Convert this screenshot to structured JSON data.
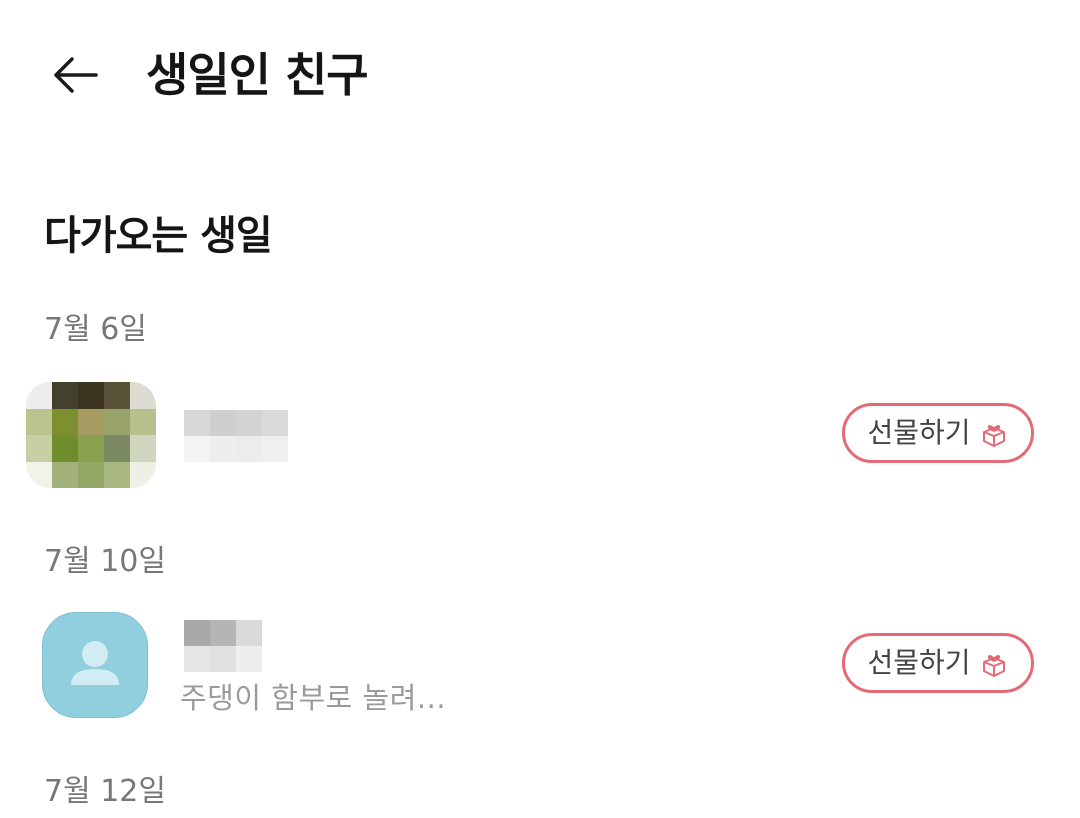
{
  "header": {
    "back_icon": "arrow-left-icon",
    "title": "생일인 친구"
  },
  "section": {
    "title": "다가오는 생일"
  },
  "birthdays": [
    {
      "date": "7월 6일",
      "friend": {
        "avatar": "pixelated-photo",
        "name_hidden": true,
        "status": ""
      },
      "gift_label": "선물하기",
      "gift_icon": "gift-box-heart-icon"
    },
    {
      "date": "7월 10일",
      "friend": {
        "avatar": "default-person-icon",
        "name_hidden": true,
        "status": "주댕이 함부로 놀려..."
      },
      "gift_label": "선물하기",
      "gift_icon": "gift-box-heart-icon"
    },
    {
      "date": "7월 12일"
    }
  ],
  "colors": {
    "accent": "#e46b75",
    "avatar_default_bg": "#91cfdf",
    "secondary_text": "#777777"
  }
}
